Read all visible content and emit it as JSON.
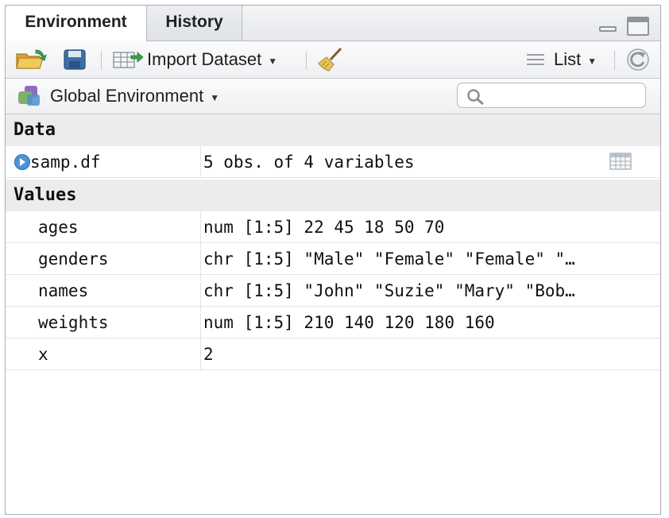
{
  "tabs": [
    {
      "label": "Environment",
      "active": true
    },
    {
      "label": "History",
      "active": false
    }
  ],
  "toolbar": {
    "import_label": "Import Dataset",
    "view_label": "List"
  },
  "environment": {
    "scope_label": "Global Environment",
    "search_placeholder": ""
  },
  "sections": {
    "data": "Data",
    "values": "Values"
  },
  "data_rows": [
    {
      "name": "samp.df",
      "value": "5 obs. of 4 variables"
    }
  ],
  "value_rows": [
    {
      "name": "ages",
      "value": "num [1:5] 22 45 18 50 70"
    },
    {
      "name": "genders",
      "value": "chr [1:5] \"Male\" \"Female\" \"Female\" \"…"
    },
    {
      "name": "names",
      "value": "chr [1:5] \"John\" \"Suzie\" \"Mary\" \"Bob…"
    },
    {
      "name": "weights",
      "value": "num [1:5] 210 140 120 180 160"
    },
    {
      "name": "x",
      "value": "2"
    }
  ],
  "icons": {
    "open": "open-folder-icon",
    "save": "save-icon",
    "import": "import-dataset-icon",
    "clear": "broom-icon",
    "list": "list-icon",
    "refresh": "refresh-icon",
    "env": "environment-icon",
    "search": "search-icon",
    "expand": "expand-icon",
    "view_data": "table-grid-icon"
  }
}
